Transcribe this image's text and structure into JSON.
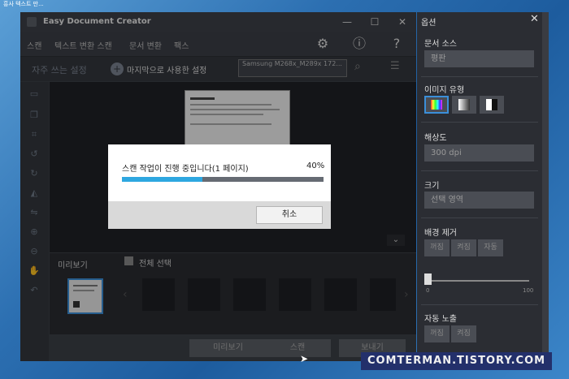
{
  "desktop": {
    "corner_text": "흥사 텍스트 만..."
  },
  "window": {
    "title": "Easy Document Creator",
    "controls": {
      "minimize": "—",
      "maximize": "☐",
      "close": "✕"
    }
  },
  "menu": {
    "items": [
      "스캔",
      "텍스트 변환 스캔",
      "문서 변환",
      "팩스"
    ],
    "icons": [
      "gear-icon",
      "info-icon",
      "help-icon"
    ]
  },
  "toolbar": {
    "frequent_settings": "자주 쓰는 설정",
    "last_used": "마지막으로 사용한 설정",
    "scanner": "Samsung M268x_M289x 172..."
  },
  "preview": {
    "label": "미리보기",
    "select_all": "전체 선택"
  },
  "bottom_buttons": {
    "preview": "미리보기",
    "scan": "스캔",
    "send": "보내기"
  },
  "dialog": {
    "message": "스캔 작업이 진행 중입니다(1 페이지)",
    "percent_text": "40%",
    "progress": 0.4,
    "cancel": "취소"
  },
  "options": {
    "title": "옵션",
    "close": "✕",
    "doc_source_label": "문서 소스",
    "doc_source_value": "평판",
    "image_type_label": "이미지 유형",
    "resolution_label": "해상도",
    "resolution_value": "300 dpi",
    "size_label": "크기",
    "size_value": "선택 영역",
    "bg_remove_label": "배경 제거",
    "bg_remove_options": [
      "꺼짐",
      "켜짐",
      "자동"
    ],
    "slider_min": "0",
    "slider_max": "100",
    "slider_value": 0,
    "auto_exposure_label": "자동 노출",
    "auto_exposure_options": [
      "꺼짐",
      "켜짐"
    ]
  },
  "watermark": "COMTERMAN.TISTORY.COM"
}
